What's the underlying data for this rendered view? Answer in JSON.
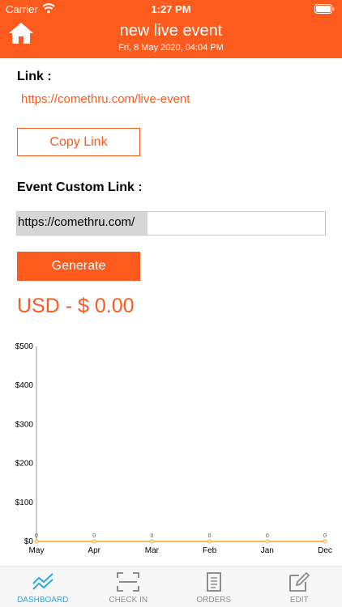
{
  "status_bar": {
    "carrier": "Carrier",
    "time": "1:27 PM"
  },
  "header": {
    "title": "new live event",
    "date": "Fri, 8 May 2020, 04:04 PM",
    "accent_color": "#fd5a1e"
  },
  "link_section": {
    "label": "Link :",
    "url": "https://comethru.com/live-event",
    "copy_label": "Copy Link"
  },
  "custom_link": {
    "label": "Event Custom Link :",
    "prefix": "https://comethru.com/",
    "value": "",
    "generate_label": "Generate"
  },
  "totals": {
    "amount_text": "USD - $ 0.00"
  },
  "chart_data": {
    "type": "line",
    "categories": [
      "May",
      "Apr",
      "Mar",
      "Feb",
      "Jan",
      "Dec"
    ],
    "series": [
      {
        "values": [
          0,
          0,
          0,
          0,
          0,
          0
        ],
        "color": "#f5a623"
      }
    ],
    "data_labels": [
      "0",
      "0",
      "0",
      "0",
      "0",
      "0"
    ],
    "y_ticks": [
      "$0",
      "$100",
      "$200",
      "$300",
      "$400",
      "$500"
    ],
    "ylim": [
      0,
      500
    ],
    "grid": false
  },
  "tabs": [
    {
      "label": "DASHBOARD",
      "icon": "chart-line-icon",
      "active": true
    },
    {
      "label": "CHECK IN",
      "icon": "scan-icon",
      "active": false
    },
    {
      "label": "ORDERS",
      "icon": "receipt-icon",
      "active": false
    },
    {
      "label": "EDIT",
      "icon": "edit-icon",
      "active": false
    }
  ]
}
